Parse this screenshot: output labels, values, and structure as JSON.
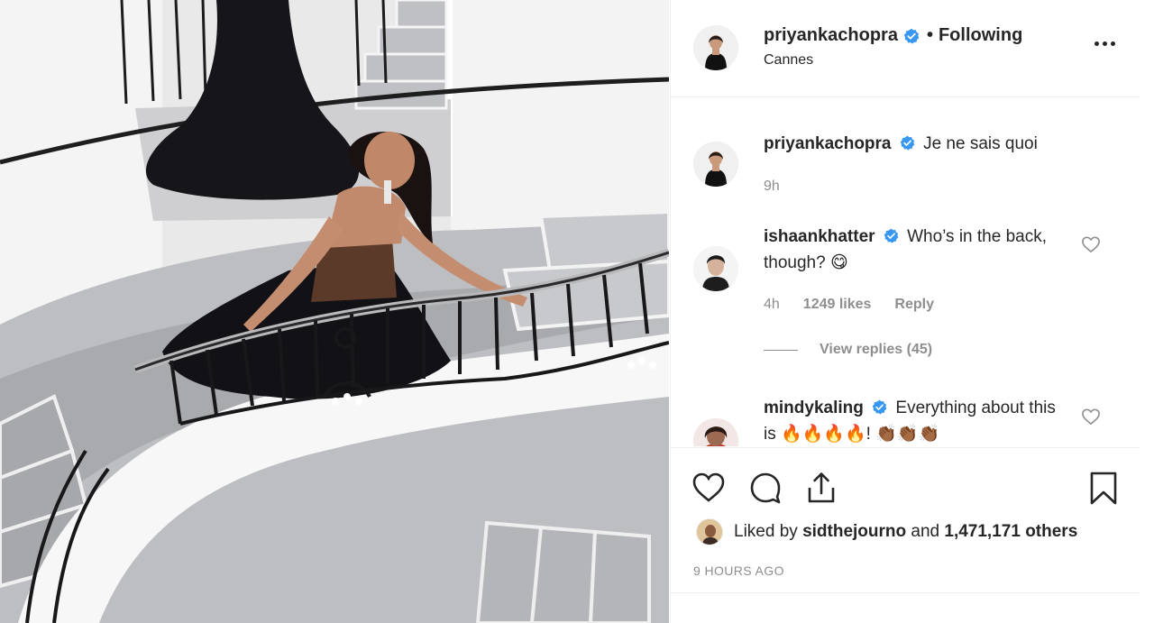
{
  "post": {
    "username": "priyankachopra",
    "separator": "•",
    "follow_status": "Following",
    "location": "Cannes",
    "more_label": "More options"
  },
  "comments": [
    {
      "username": "priyankachopra",
      "text": "Je ne sais quoi",
      "time": "9h"
    },
    {
      "username": "ishaankhatter",
      "text": "Who’s in the back, though? 😋",
      "time": "4h",
      "likes": "1249 likes",
      "reply": "Reply",
      "view_replies": "View replies (45)"
    },
    {
      "username": "mindykaling",
      "text": "Everything about this is 🔥🔥🔥🔥! 👏🏾👏🏾👏🏾"
    }
  ],
  "actions": {
    "icons": [
      "heart-icon",
      "comment-icon",
      "share-icon",
      "bookmark-icon"
    ]
  },
  "likes": {
    "prefix": "Liked by",
    "user": "sidthejourno",
    "middle": "and",
    "count": "1,471,171 others"
  },
  "timestamp": "9 HOURS AGO",
  "colors": {
    "text": "#262626",
    "secondary": "#8e8e8e",
    "verified": "#3897f0",
    "divider": "#efefef"
  }
}
